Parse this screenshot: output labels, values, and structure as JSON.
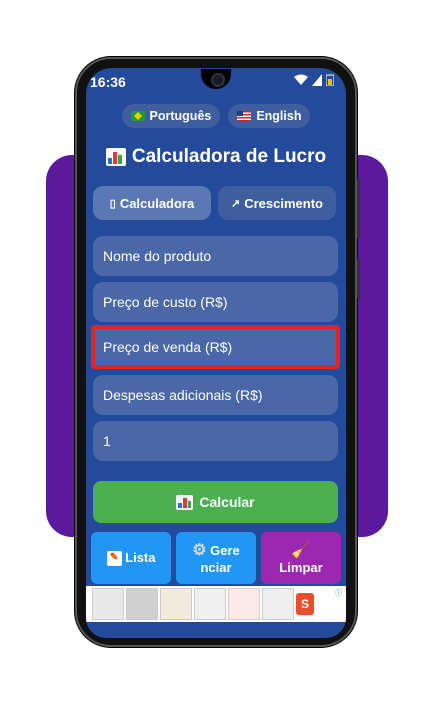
{
  "status": {
    "time": "16:36"
  },
  "languages": [
    {
      "label": "Português",
      "flag": "brazil-flag"
    },
    {
      "label": "English",
      "flag": "us-flag"
    }
  ],
  "app": {
    "title": "Calculadora de Lucro"
  },
  "tabs": [
    {
      "label": "Calculadora",
      "icon": "calculator-icon",
      "active": true
    },
    {
      "label": "Crescimento",
      "icon": "trend-icon",
      "active": false
    }
  ],
  "fields": {
    "product_name": {
      "placeholder": "Nome do produto"
    },
    "cost_price": {
      "placeholder": "Preço de custo (R$)"
    },
    "sale_price": {
      "placeholder": "Preço de venda (R$)"
    },
    "extra_expenses": {
      "placeholder": "Despesas adicionais (R$)"
    },
    "quantity": {
      "value": "1"
    }
  },
  "buttons": {
    "calculate": "Calcular",
    "list": "Lista",
    "manage_line1": "Gere",
    "manage_line2": "nciar",
    "clear": "Limpar"
  },
  "colors": {
    "background": "#244a9c",
    "field": "#4a68a8",
    "calculate": "#4caf50",
    "list": "#2196f3",
    "manage": "#2196f3",
    "clear": "#9c27b0",
    "highlight": "#e2232a",
    "card": "#5b1a9e"
  }
}
